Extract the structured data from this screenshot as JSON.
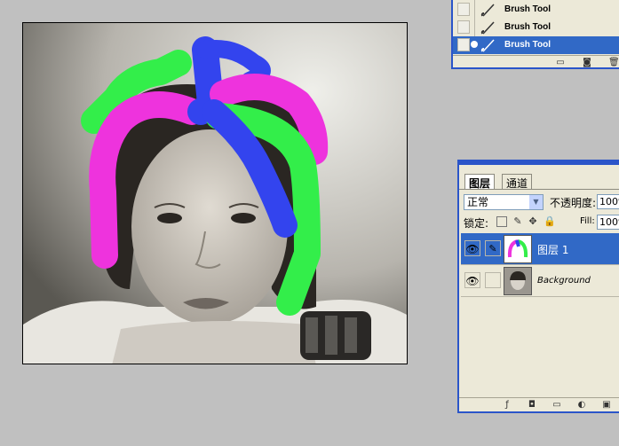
{
  "history": {
    "items": [
      {
        "label": "Brush Tool",
        "selected": false
      },
      {
        "label": "Brush Tool",
        "selected": false
      },
      {
        "label": "Brush Tool",
        "selected": true
      }
    ],
    "footer_icons": [
      "new-snapshot-icon",
      "camera-icon",
      "trash-icon"
    ]
  },
  "layers": {
    "tabs": [
      {
        "label": "图层",
        "active": true
      },
      {
        "label": "通道",
        "active": false
      }
    ],
    "blend_mode": "正常",
    "opacity_label": "不透明度:",
    "opacity_value": "100%",
    "lock_label": "锁定:",
    "fill_label": "Fill:",
    "fill_value": "100%",
    "list": [
      {
        "name": "图层 1",
        "selected": true
      },
      {
        "name": "Background",
        "selected": false
      }
    ],
    "footer_icons": [
      "add-style-icon",
      "mask-icon",
      "new-set-icon",
      "adjustment-icon",
      "new-layer-icon"
    ]
  },
  "colors": {
    "selection": "#3169c6",
    "panel_border": "#2b55c9",
    "stroke_green": "#33ee4a",
    "stroke_magenta": "#ee33dd",
    "stroke_blue": "#3344ee"
  }
}
